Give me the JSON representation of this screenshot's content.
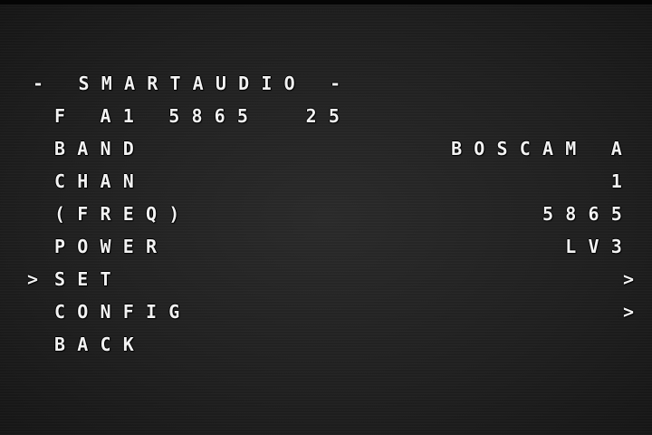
{
  "title": "- SMARTAUDIO -",
  "status_line": "F A1 5865  25",
  "cursor": ">",
  "menu": {
    "band": {
      "label": "BAND",
      "value": "BOSCAM A"
    },
    "chan": {
      "label": "CHAN",
      "value": "1"
    },
    "freq": {
      "label": "(FREQ)",
      "value": "5865"
    },
    "power": {
      "label": "POWER",
      "value": "LV3"
    },
    "set": {
      "label": "SET",
      "value": ">"
    },
    "config": {
      "label": "CONFIG",
      "value": ">"
    },
    "back": {
      "label": "BACK"
    }
  }
}
